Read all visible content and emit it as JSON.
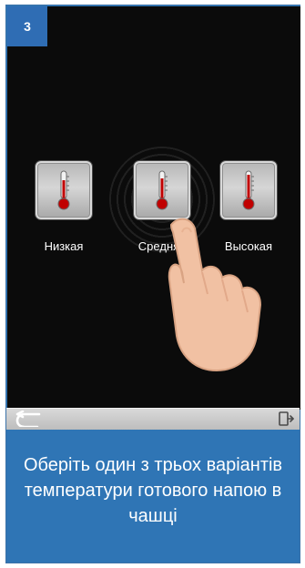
{
  "step": {
    "number": "3"
  },
  "options": [
    {
      "label": "Низкая",
      "icon": "thermometer-icon"
    },
    {
      "label": "Средняя",
      "icon": "thermometer-icon"
    },
    {
      "label": "Высокая",
      "icon": "thermometer-icon"
    }
  ],
  "bottom_bar": {
    "back_icon": "back-arrow-icon",
    "exit_icon": "exit-door-icon"
  },
  "caption": {
    "text": "Оберіть один з трьох варіантів температури готового напою в чашці"
  },
  "colors": {
    "frame_blue": "#2f75b5",
    "screen_black": "#0b0b0b",
    "badge_blue": "#2f6db4",
    "tile_gray": "#c8c8c8",
    "thermo_red": "#c00000"
  }
}
